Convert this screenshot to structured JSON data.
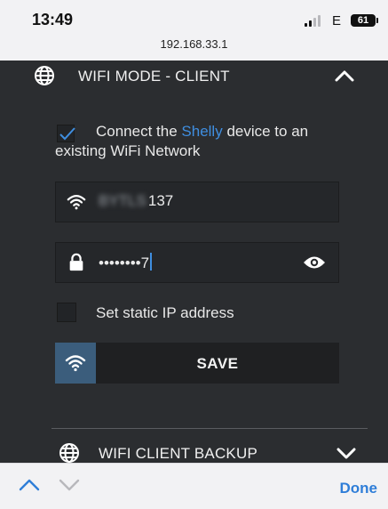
{
  "status_bar": {
    "time": "13:49",
    "network": "E",
    "battery": "61"
  },
  "url_bar": {
    "url": "192.168.33.1"
  },
  "wifi_client": {
    "title": "WIFI MODE - CLIENT",
    "connect_checked": true,
    "connect_prefix": "Connect the ",
    "connect_brand": "Shelly",
    "connect_suffix": " device to an existing WiFi Network",
    "ssid_hidden": "BYTLS",
    "ssid_visible": "137",
    "password_mask": "••••••••7",
    "static_ip_checked": false,
    "static_ip_label": "Set static IP address",
    "save_label": "SAVE"
  },
  "wifi_backup": {
    "title": "WIFI CLIENT BACKUP"
  },
  "keyboard_toolbar": {
    "done_label": "Done"
  },
  "colors": {
    "accent": "#3f8ee0",
    "panel": "#2b2d30",
    "save_icon_bg": "#3b5d7c"
  }
}
